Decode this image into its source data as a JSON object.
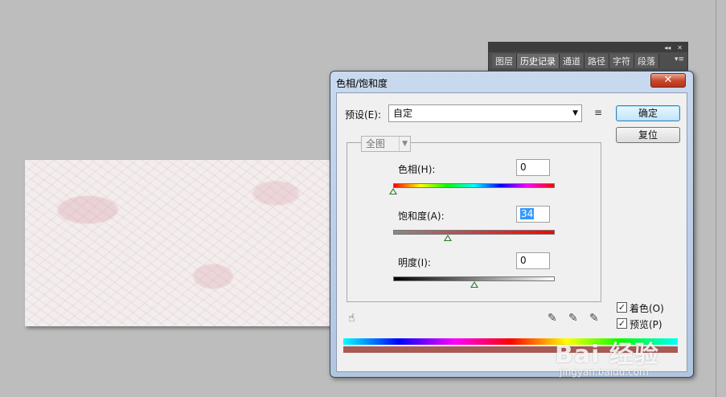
{
  "panel": {
    "tabs": [
      "图层",
      "历史记录",
      "通道",
      "路径",
      "字符",
      "段落"
    ],
    "collapse_glyph": "◂◂",
    "close_glyph": "✕",
    "menu_glyph": "▾≡"
  },
  "dialog": {
    "title": "色相/饱和度",
    "close_glyph": "✕",
    "preset_label": "预设(E):",
    "preset_value": "自定",
    "preset_arrow": "▼",
    "preset_menu_icon": "≡",
    "ok_label": "确定",
    "reset_label": "复位",
    "channel_value": "全图",
    "channel_arrow": "▼",
    "hue_label": "色相(H):",
    "hue_value": "0",
    "saturation_label": "饱和度(A):",
    "saturation_value": "34",
    "lightness_label": "明度(I):",
    "lightness_value": "0",
    "colorize_label": "着色(O)",
    "colorize_checked": true,
    "preview_label": "预览(P)",
    "preview_checked": true,
    "check_glyph": "✓",
    "hand_tool_icon": "☝",
    "eyedropper_icon": "✎",
    "eyedropper_plus_icon": "✎",
    "eyedropper_minus_icon": "✎",
    "hue_slider_level": 0,
    "saturation_slider_level": 0.34,
    "lightness_slider_level": 0,
    "colorized_color": "#a85a55"
  },
  "watermark": {
    "logo": "Bai 经验",
    "url": "jingyan.baidu.com"
  }
}
